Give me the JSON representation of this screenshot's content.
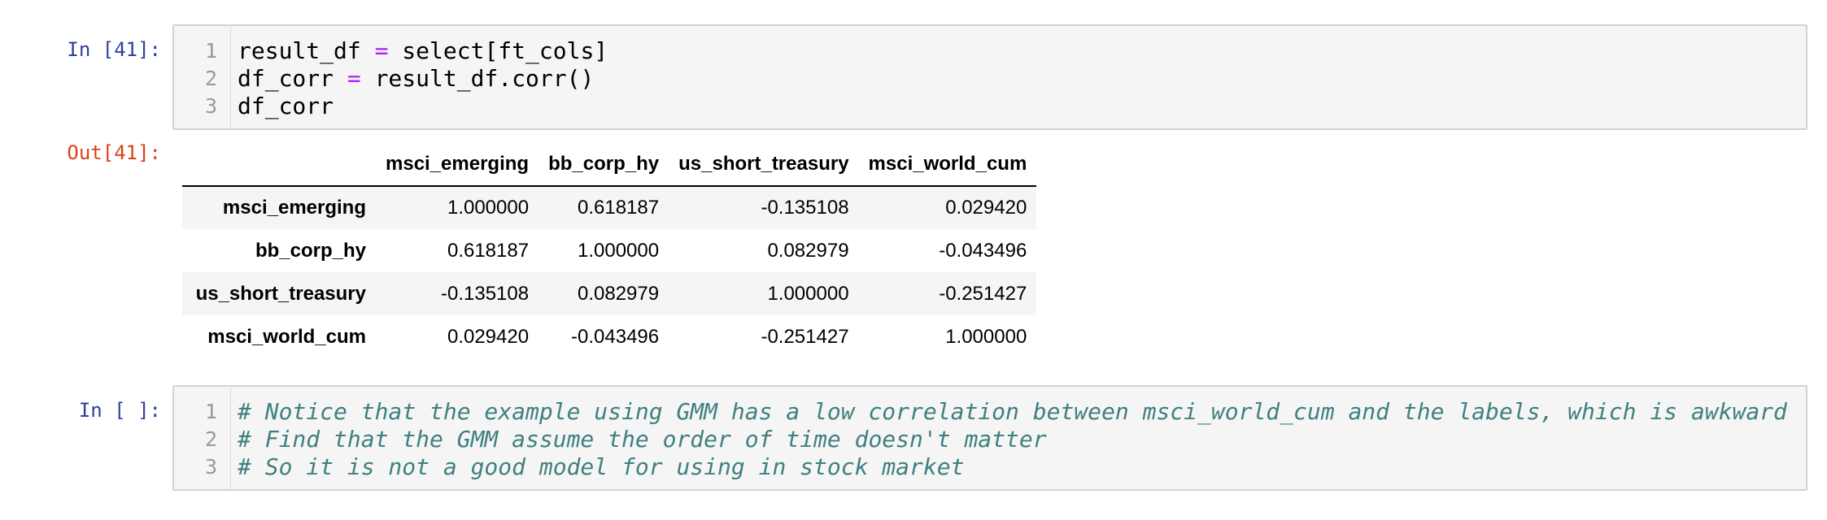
{
  "cells": {
    "cell1": {
      "prompt": "In [41]:",
      "lines": [
        {
          "num": "1",
          "parts": [
            "result_df ",
            "=",
            " select[ft_cols]"
          ]
        },
        {
          "num": "2",
          "parts": [
            "df_corr ",
            "=",
            " result_df.corr()"
          ]
        },
        {
          "num": "3",
          "parts": [
            "df_corr",
            "",
            ""
          ]
        }
      ],
      "output_prompt": "Out[41]:"
    },
    "cell2": {
      "prompt": "In [ ]:",
      "lines": [
        {
          "num": "1",
          "text": "# Notice that the example using GMM has a low correlation between msci_world_cum and the labels, which is awkward"
        },
        {
          "num": "2",
          "text": "# Find that the GMM assume the order of time doesn't matter"
        },
        {
          "num": "3",
          "text": "# So it is not a good model for using in stock market"
        }
      ]
    }
  },
  "dataframe": {
    "columns": [
      "msci_emerging",
      "bb_corp_hy",
      "us_short_treasury",
      "msci_world_cum"
    ],
    "rows": [
      {
        "index": "msci_emerging",
        "values": [
          "1.000000",
          "0.618187",
          "-0.135108",
          "0.029420"
        ]
      },
      {
        "index": "bb_corp_hy",
        "values": [
          "0.618187",
          "1.000000",
          "0.082979",
          "-0.043496"
        ]
      },
      {
        "index": "us_short_treasury",
        "values": [
          "-0.135108",
          "0.082979",
          "1.000000",
          "-0.251427"
        ]
      },
      {
        "index": "msci_world_cum",
        "values": [
          "0.029420",
          "-0.043496",
          "-0.251427",
          "1.000000"
        ]
      }
    ]
  },
  "colors": {
    "in_prompt": "#303F9F",
    "out_prompt": "#D84315",
    "operator": "#AA22FF",
    "comment": "#408080",
    "cell_background": "#f5f5f5"
  }
}
